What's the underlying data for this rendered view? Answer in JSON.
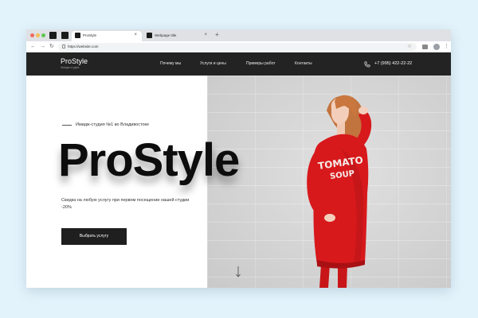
{
  "browser": {
    "tabs": [
      {
        "title": "ProStyle",
        "close": "×"
      },
      {
        "title": "Webpage title",
        "close": "×"
      }
    ],
    "new_tab": "+",
    "url": "https://website.com",
    "nav": {
      "back": "←",
      "forward": "→",
      "reload": "↻"
    },
    "star": "☆",
    "menu": "⋮"
  },
  "site": {
    "logo": "ProStyle",
    "logo_subtitle": "Имидж-студия",
    "nav": [
      "Почему мы",
      "Услуги и цены",
      "Примеры работ",
      "Контакты"
    ],
    "phone": "+7 (995) 422-22-22"
  },
  "hero": {
    "tagline": "Имидж-студия №1 во Владивостоке",
    "title": "ProStyle",
    "description": "Скидка на любую услугу при первом посещении нашей студии -20%",
    "cta": "Выбрать услугу",
    "sweater_text_line1": "TOMATO",
    "sweater_text_line2": "SOUP"
  },
  "colors": {
    "background": "#e3f3fb",
    "header": "#232323",
    "button": "#1f1f1f",
    "sweater": "#d7191c",
    "wall": "#d6d6d6"
  },
  "icons": [
    "lock-icon",
    "star-icon",
    "phone-icon",
    "arrow-down-icon"
  ]
}
